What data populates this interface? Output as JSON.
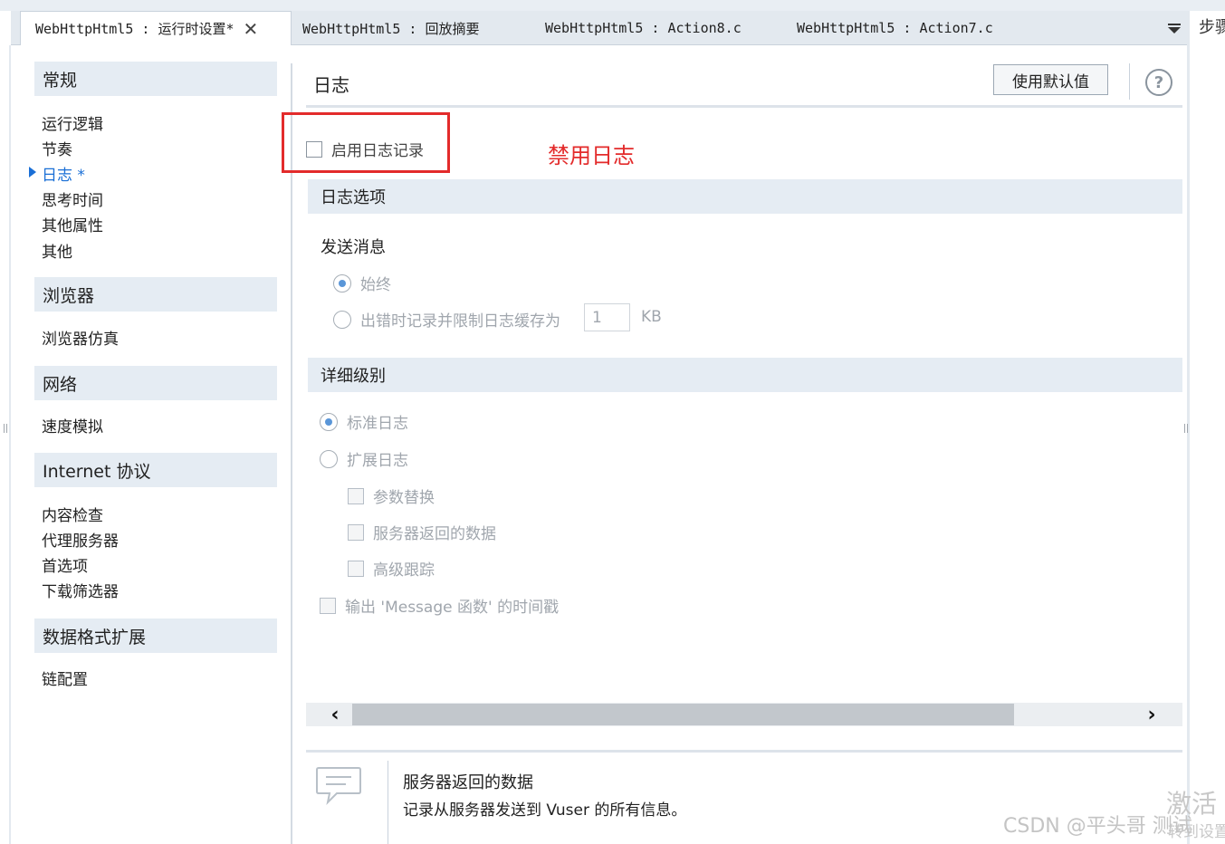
{
  "tabs": [
    {
      "label": "WebHttpHtml5 : 运行时设置*",
      "active": true,
      "close": "✕"
    },
    {
      "label": "WebHttpHtml5 : 回放摘要",
      "active": false
    },
    {
      "label": "WebHttpHtml5 : Action8.c",
      "active": false
    },
    {
      "label": "WebHttpHtml5 : Action7.c",
      "active": false
    }
  ],
  "right_panel_label": "步骤",
  "sidebar": {
    "sections": [
      {
        "title": "常规",
        "items": [
          "运行逻辑",
          "节奏",
          "日志 *",
          "思考时间",
          "其他属性",
          "其他"
        ]
      },
      {
        "title": "浏览器",
        "items": [
          "浏览器仿真"
        ]
      },
      {
        "title": "网络",
        "items": [
          "速度模拟"
        ]
      },
      {
        "title": "Internet 协议",
        "items": [
          "内容检查",
          "代理服务器",
          "首选项",
          "下载筛选器"
        ]
      },
      {
        "title": "数据格式扩展",
        "items": [
          "链配置"
        ]
      }
    ],
    "selected": "日志 *"
  },
  "main": {
    "title": "日志",
    "default_button": "使用默认值",
    "help": "?",
    "enable_logging": {
      "label": "启用日志记录",
      "checked": false
    },
    "annotation": "禁用日志",
    "log_options": {
      "title": "日志选项",
      "send_messages": "发送消息",
      "always": "始终",
      "on_error": "出错时记录并限制日志缓存为",
      "cache_value": "1",
      "cache_unit": "KB"
    },
    "detail": {
      "title": "详细级别",
      "standard": "标准日志",
      "extended": "扩展日志",
      "param_sub": "参数替换",
      "server_data": "服务器返回的数据",
      "advanced_trace": "高级跟踪",
      "timestamp": "输出 'Message 函数' 的时间戳"
    },
    "scrollbar": {
      "left": "‹",
      "right": "›"
    },
    "description": {
      "title": "服务器返回的数据",
      "text": "记录从服务器发送到 Vuser 的所有信息。"
    }
  },
  "watermark": "CSDN @平头哥 测试",
  "activate": {
    "line1": "激活",
    "line2": "转到设置"
  },
  "colors": {
    "accent": "#1a6fd6",
    "annotation": "#e32b2b",
    "band": "#e5ecf3"
  }
}
